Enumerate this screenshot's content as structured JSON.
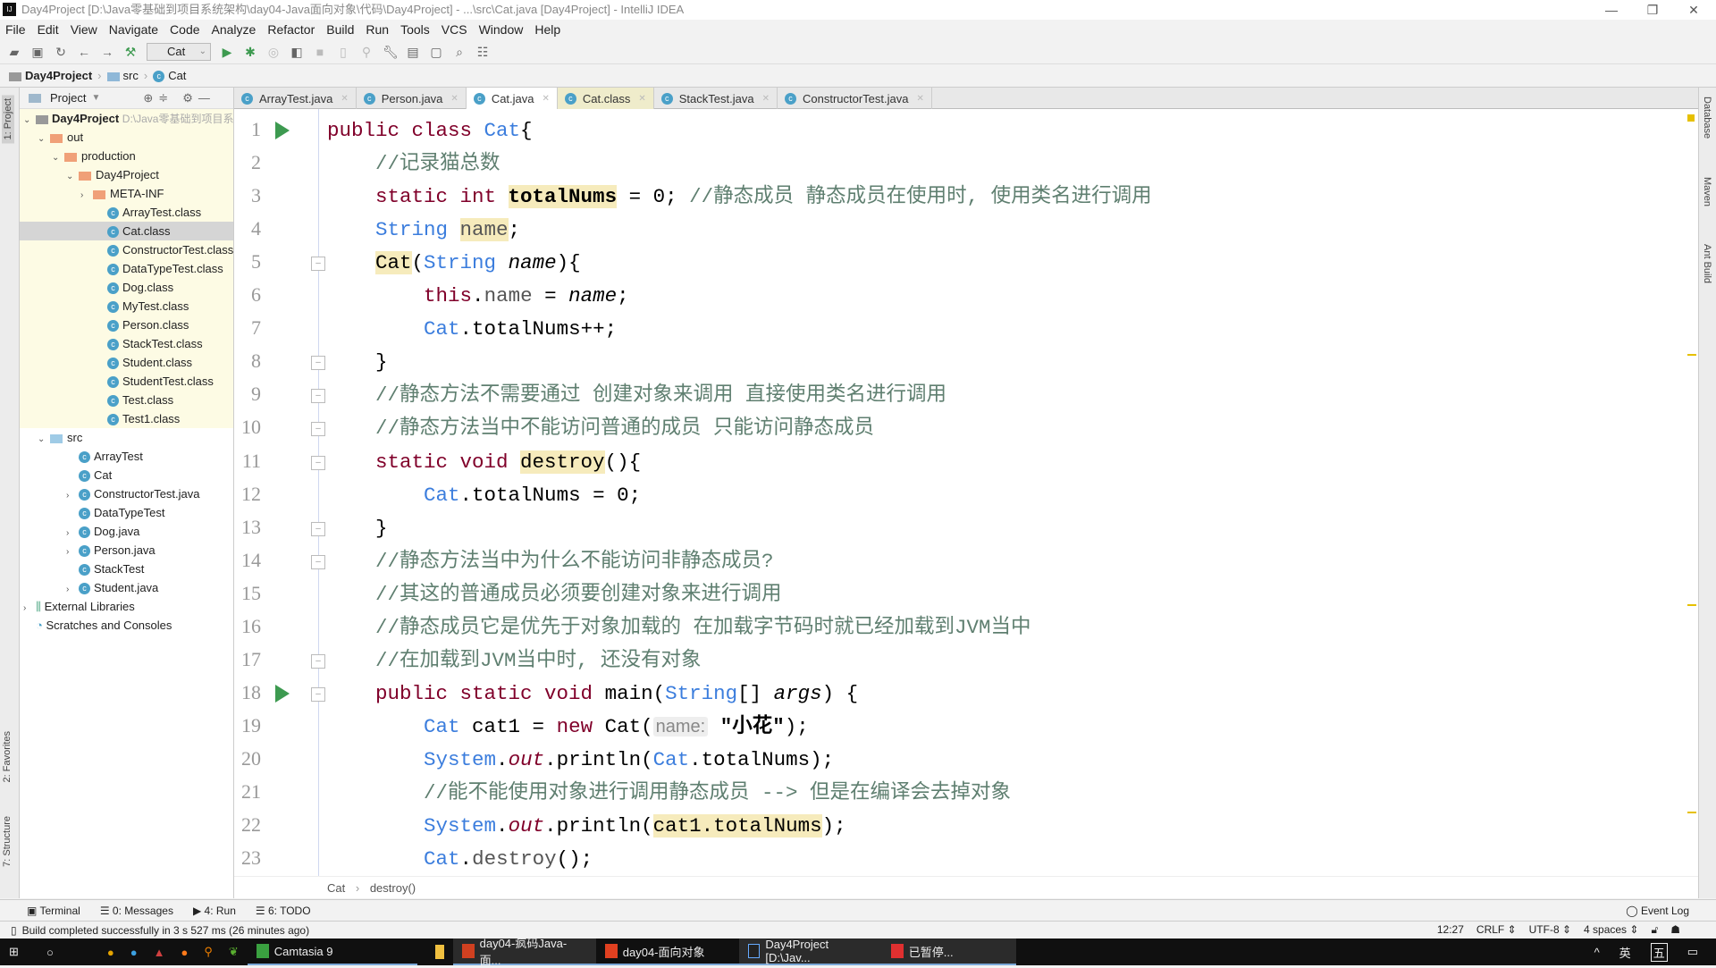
{
  "window": {
    "title": "Day4Project [D:\\Java零基础到项目系统架构\\day04-Java面向对象\\代码\\Day4Project] - ...\\src\\Cat.java [Day4Project] - IntelliJ IDEA"
  },
  "menu": [
    "File",
    "Edit",
    "View",
    "Navigate",
    "Code",
    "Analyze",
    "Refactor",
    "Build",
    "Run",
    "Tools",
    "VCS",
    "Window",
    "Help"
  ],
  "toolbar": {
    "run_config": "Cat"
  },
  "navbar": {
    "items": [
      "Day4Project",
      "src",
      "Cat"
    ]
  },
  "project_panel": {
    "title": "Project",
    "root": "Day4Project",
    "root_path": "D:\\Java零基础到项目系",
    "tree": [
      {
        "label": "out",
        "depth": 1,
        "kind": "ofold",
        "arrow": "v"
      },
      {
        "label": "production",
        "depth": 2,
        "kind": "ofold",
        "arrow": "v"
      },
      {
        "label": "Day4Project",
        "depth": 3,
        "kind": "ofold",
        "arrow": "v"
      },
      {
        "label": "META-INF",
        "depth": 4,
        "kind": "ofold",
        "arrow": ">"
      },
      {
        "label": "ArrayTest.class",
        "depth": 5,
        "kind": "c"
      },
      {
        "label": "Cat.class",
        "depth": 5,
        "kind": "c",
        "selected": true
      },
      {
        "label": "ConstructorTest.class",
        "depth": 5,
        "kind": "c"
      },
      {
        "label": "DataTypeTest.class",
        "depth": 5,
        "kind": "c"
      },
      {
        "label": "Dog.class",
        "depth": 5,
        "kind": "c"
      },
      {
        "label": "MyTest.class",
        "depth": 5,
        "kind": "c"
      },
      {
        "label": "Person.class",
        "depth": 5,
        "kind": "c"
      },
      {
        "label": "StackTest.class",
        "depth": 5,
        "kind": "c"
      },
      {
        "label": "Student.class",
        "depth": 5,
        "kind": "c"
      },
      {
        "label": "StudentTest.class",
        "depth": 5,
        "kind": "c"
      },
      {
        "label": "Test.class",
        "depth": 5,
        "kind": "c"
      },
      {
        "label": "Test1.class",
        "depth": 5,
        "kind": "c"
      },
      {
        "label": "src",
        "depth": 1,
        "kind": "bfold",
        "arrow": "v",
        "plain": true
      },
      {
        "label": "ArrayTest",
        "depth": 3,
        "kind": "c",
        "plain": true
      },
      {
        "label": "Cat",
        "depth": 3,
        "kind": "c",
        "plain": true
      },
      {
        "label": "ConstructorTest.java",
        "depth": 3,
        "kind": "c",
        "arrow": ">",
        "plain": true
      },
      {
        "label": "DataTypeTest",
        "depth": 3,
        "kind": "c",
        "plain": true
      },
      {
        "label": "Dog.java",
        "depth": 3,
        "kind": "c",
        "arrow": ">",
        "plain": true
      },
      {
        "label": "Person.java",
        "depth": 3,
        "kind": "c",
        "arrow": ">",
        "plain": true
      },
      {
        "label": "StackTest",
        "depth": 3,
        "kind": "c",
        "plain": true
      },
      {
        "label": "Student.java",
        "depth": 3,
        "kind": "c",
        "arrow": ">",
        "plain": true
      },
      {
        "label": "External Libraries",
        "depth": 0,
        "kind": "lib",
        "arrow": ">",
        "plain": true
      },
      {
        "label": "Scratches and Consoles",
        "depth": 0,
        "kind": "scratch",
        "plain": true
      }
    ]
  },
  "tabs": [
    {
      "label": "ArrayTest.java"
    },
    {
      "label": "Person.java"
    },
    {
      "label": "Cat.java",
      "active": true
    },
    {
      "label": "Cat.class",
      "cls": true
    },
    {
      "label": "StackTest.java"
    },
    {
      "label": "ConstructorTest.java"
    }
  ],
  "editor": {
    "lines": [
      [
        [
          "kw",
          "public class "
        ],
        [
          "ty",
          "Cat"
        ],
        [
          "",
          "{"
        ]
      ],
      [
        [
          "",
          "    "
        ],
        [
          "cm",
          "//记录猫总数"
        ]
      ],
      [
        [
          "",
          "    "
        ],
        [
          "kw",
          "static int "
        ],
        [
          "hl bold",
          "totalNums"
        ],
        [
          "",
          " = 0; "
        ],
        [
          "cm",
          "//静态成员 静态成员在使用时, 使用类名进行调用"
        ]
      ],
      [
        [
          "",
          "    "
        ],
        [
          "ty",
          "String "
        ],
        [
          "hl fd",
          "name"
        ],
        [
          "",
          ";"
        ]
      ],
      [
        [
          "",
          "    "
        ],
        [
          "hl",
          "Cat"
        ],
        [
          "",
          "("
        ],
        [
          "ty",
          "String "
        ],
        [
          "it",
          "name"
        ],
        [
          "",
          ")"
        ],
        [
          "",
          "{"
        ]
      ],
      [
        [
          "",
          "        "
        ],
        [
          "kw",
          "this"
        ],
        [
          "",
          "."
        ],
        [
          "fd",
          "name"
        ],
        [
          "",
          " = "
        ],
        [
          "it",
          "name"
        ],
        [
          "",
          ";"
        ]
      ],
      [
        [
          "",
          "        "
        ],
        [
          "ty",
          "Cat"
        ],
        [
          "",
          ".totalNums++;"
        ]
      ],
      [
        [
          "",
          "    }"
        ]
      ],
      [
        [
          "",
          "    "
        ],
        [
          "cm",
          "//静态方法不需要通过 创建对象来调用 直接使用类名进行调用"
        ]
      ],
      [
        [
          "",
          "    "
        ],
        [
          "cm",
          "//静态方法当中不能访问普通的成员 只能访问静态成员"
        ]
      ],
      [
        [
          "",
          "    "
        ],
        [
          "kw",
          "static void "
        ],
        [
          "hl",
          "destroy"
        ],
        [
          "",
          "(){"
        ]
      ],
      [
        [
          "",
          "        "
        ],
        [
          "ty",
          "Cat"
        ],
        [
          "",
          ".totalNums = 0;"
        ]
      ],
      [
        [
          "",
          "    }"
        ]
      ],
      [
        [
          "",
          "    "
        ],
        [
          "cm",
          "//静态方法当中为什么不能访问非静态成员?"
        ]
      ],
      [
        [
          "",
          "    "
        ],
        [
          "cm",
          "//其这的普通成员必须要创建对象来进行调用"
        ]
      ],
      [
        [
          "",
          "    "
        ],
        [
          "cm",
          "//静态成员它是优先于对象加载的 在加载字节码时就已经加载到JVM当中"
        ]
      ],
      [
        [
          "",
          "    "
        ],
        [
          "cm",
          "//在加载到JVM当中时, 还没有对象"
        ]
      ],
      [
        [
          "",
          "    "
        ],
        [
          "kw",
          "public static void "
        ],
        [
          "",
          "main("
        ],
        [
          "ty",
          "String"
        ],
        [
          "",
          "[] "
        ],
        [
          "it",
          "args"
        ],
        [
          "",
          ") {"
        ]
      ],
      [
        [
          "",
          "        "
        ],
        [
          "ty",
          "Cat "
        ],
        [
          "",
          "cat1 = "
        ],
        [
          "kw",
          "new "
        ],
        [
          "",
          "Cat("
        ],
        [
          "hint",
          "name:"
        ],
        [
          "str",
          " \"小花\""
        ],
        [
          "",
          ");"
        ]
      ],
      [
        [
          "",
          "        "
        ],
        [
          "ty",
          "System"
        ],
        [
          "",
          "."
        ],
        [
          "it kw",
          "out"
        ],
        [
          "",
          ".println("
        ],
        [
          "ty",
          "Cat"
        ],
        [
          "",
          ".totalNums);"
        ]
      ],
      [
        [
          "",
          "        "
        ],
        [
          "cm",
          "//能不能使用对象进行调用静态成员 --> 但是在编译会去掉对象"
        ]
      ],
      [
        [
          "",
          "        "
        ],
        [
          "ty",
          "System"
        ],
        [
          "",
          "."
        ],
        [
          "it kw",
          "out"
        ],
        [
          "",
          ".println("
        ],
        [
          "hl",
          "cat1.totalNums"
        ],
        [
          "",
          ");"
        ]
      ],
      [
        [
          "",
          "        "
        ],
        [
          "ty",
          "Cat"
        ],
        [
          "",
          "."
        ],
        [
          "fd",
          "destroy"
        ],
        [
          "",
          "();"
        ]
      ]
    ],
    "run_lines": [
      1,
      18
    ],
    "fold_lines": [
      5,
      8,
      9,
      10,
      11,
      13,
      14,
      17,
      18
    ]
  },
  "breadcrumb": [
    "Cat",
    "destroy()"
  ],
  "left_stripe": [
    "1: Project",
    "2: Favorites",
    "7: Structure"
  ],
  "right_stripe": [
    "Database",
    "Maven",
    "Ant Build"
  ],
  "tool_tabs": [
    "Terminal",
    "0: Messages",
    "4: Run",
    "6: TODO"
  ],
  "event_log": "Event Log",
  "status": {
    "message": "Build completed successfully in 3 s 527 ms (26 minutes ago)",
    "position": "12:27",
    "line_sep": "CRLF",
    "encoding": "UTF-8",
    "indent": "4 spaces"
  },
  "taskbar": {
    "items": [
      "Camtasia 9",
      "day04-疯码Java-面...",
      "day04-面向对象",
      "Day4Project [D:\\Jav...",
      "已暂停..."
    ],
    "tray": [
      "英",
      "五"
    ]
  }
}
